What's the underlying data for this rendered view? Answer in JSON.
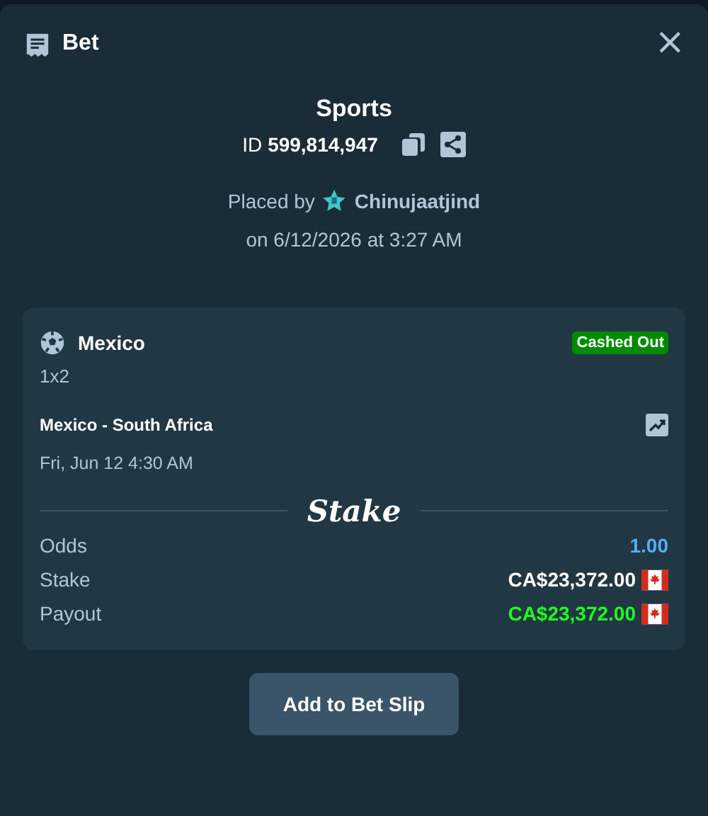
{
  "header": {
    "title": "Bet",
    "close": "×"
  },
  "summary": {
    "category": "Sports",
    "id_label": "ID",
    "id_value": "599,814,947",
    "placed_by": "Placed by",
    "user": "Chinujaatjind",
    "placed_on": "on 6/12/2026 at 3:27 AM"
  },
  "selection": {
    "team": "Mexico",
    "status": {
      "label": "Cashed Out",
      "kind": "cashed_out"
    },
    "market": "1x2",
    "event": "Mexico - South Africa",
    "start": "Fri, Jun 12  4:30 AM",
    "brand": "Stake",
    "rows": [
      {
        "label": "Odds",
        "value": "1.00",
        "kind": "odds"
      },
      {
        "label": "Stake",
        "value": "CA$23,372.00",
        "kind": "amount"
      },
      {
        "label": "Payout",
        "value": "CA$23,372.00",
        "kind": "payout"
      }
    ]
  },
  "button": "Add to Bet Slip"
}
